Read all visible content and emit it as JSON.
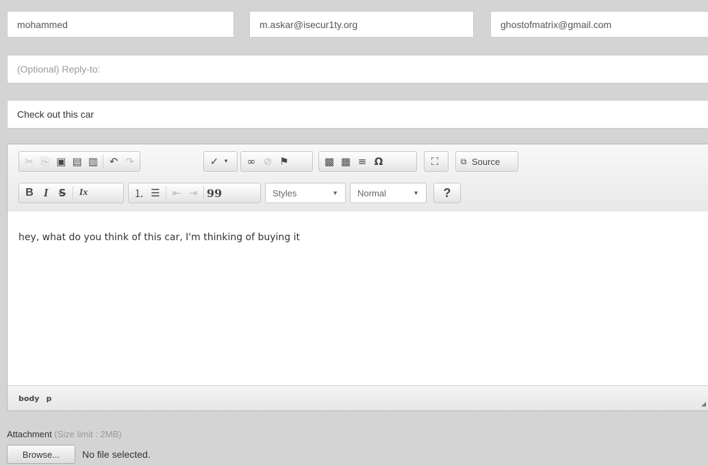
{
  "form": {
    "name_value": "mohammed",
    "from_value": "m.askar@isecur1ty.org",
    "to_value": "ghostofmatrix@gmail.com",
    "reply_placeholder": "(Optional) Reply-to:",
    "subject_value": "Check out this car"
  },
  "toolbar": {
    "row1_icons": [
      "cut-icon",
      "copy-icon",
      "paste-icon",
      "paste-text-icon",
      "paste-word-icon",
      "undo-icon",
      "redo-icon",
      "spellcheck-icon",
      "link-icon",
      "unlink-icon",
      "anchor-icon",
      "image-icon",
      "table-icon",
      "horizontal-line-icon",
      "special-char-icon",
      "maximize-icon",
      "source-icon"
    ],
    "source_label": "Source",
    "row2_icons": [
      "bold-icon",
      "italic-icon",
      "strikethrough-icon",
      "remove-format-icon",
      "numbered-list-icon",
      "bulleted-list-icon",
      "outdent-icon",
      "indent-icon",
      "blockquote-icon",
      "help-icon"
    ],
    "bold_glyph": "B",
    "italic_glyph": "I",
    "strike_glyph": "S",
    "remove_format_glyph": "Ix",
    "quote_glyph": "99",
    "help_glyph": "?",
    "special_char_glyph": "Ω",
    "styles_label": "Styles",
    "format_label": "Normal"
  },
  "editor": {
    "body_text": "hey, what do you think of this car, I'm thinking of buying it"
  },
  "statusbar": {
    "path": [
      "body",
      "p"
    ]
  },
  "attachment": {
    "label": "Attachment",
    "limit": "(Size limit : 2MB)",
    "browse_label": "Browse...",
    "file_status": "No file selected."
  }
}
